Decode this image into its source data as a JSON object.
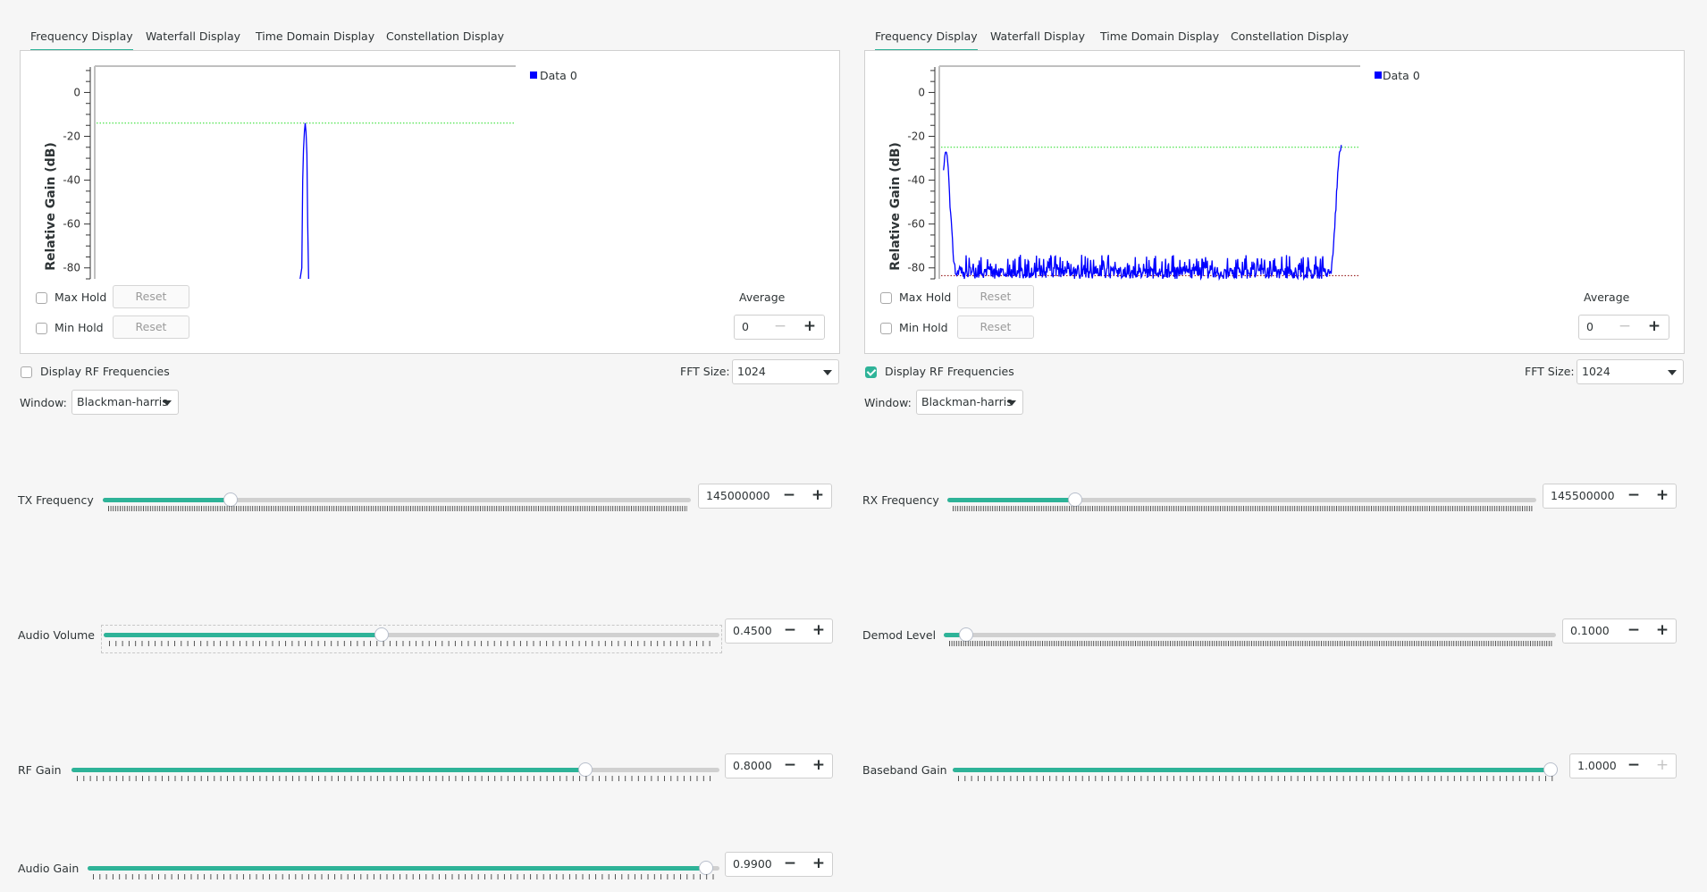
{
  "tabs": [
    "Frequency Display",
    "Waterfall Display",
    "Time Domain Display",
    "Constellation Display"
  ],
  "active_tab": 0,
  "panels": [
    {
      "id": "tx",
      "legend": "Data 0",
      "y_axis_label": "Relative Gain (dB)",
      "max_hold_label": "Max Hold",
      "min_hold_label": "Min Hold",
      "max_hold_checked": false,
      "min_hold_checked": false,
      "reset_label": "Reset",
      "average_label": "Average",
      "average_value": "0",
      "display_rf_label": "Display RF Frequencies",
      "display_rf_checked": false,
      "fft_size_label": "FFT Size:",
      "fft_size_value": "1024",
      "window_label": "Window:",
      "window_value": "Blackman-harris"
    },
    {
      "id": "rx",
      "legend": "Data 0",
      "y_axis_label": "Relative Gain (dB)",
      "max_hold_label": "Max Hold",
      "min_hold_label": "Min Hold",
      "max_hold_checked": false,
      "min_hold_checked": false,
      "reset_label": "Reset",
      "average_label": "Average",
      "average_value": "0",
      "display_rf_label": "Display RF Frequencies",
      "display_rf_checked": true,
      "fft_size_label": "FFT Size:",
      "fft_size_value": "1024",
      "window_label": "Window:",
      "window_value": "Blackman-harris"
    }
  ],
  "controls_left": [
    {
      "label": "TX Frequency",
      "value": "145000000",
      "fraction": 0.21,
      "minus_enabled": true,
      "plus_enabled": true,
      "ticks": "dense"
    },
    {
      "label": "Audio Volume",
      "value": "0.4500",
      "fraction": 0.45,
      "minus_enabled": true,
      "plus_enabled": true,
      "ticks": "sparse",
      "focused": true
    },
    {
      "label": "RF Gain",
      "value": "0.8000",
      "fraction": 0.8,
      "minus_enabled": true,
      "plus_enabled": true,
      "ticks": "sparse"
    },
    {
      "label": "Audio Gain",
      "value": "0.9900",
      "fraction": 0.99,
      "minus_enabled": true,
      "plus_enabled": true,
      "ticks": "sparse"
    }
  ],
  "controls_right": [
    {
      "label": "RX Frequency",
      "value": "145500000",
      "fraction": 0.21,
      "minus_enabled": true,
      "plus_enabled": true,
      "ticks": "dense"
    },
    {
      "label": "Demod Level",
      "value": "0.1000",
      "fraction": 0.025,
      "minus_enabled": true,
      "plus_enabled": true,
      "ticks": "dense"
    },
    {
      "label": "Baseband Gain",
      "value": "1.0000",
      "fraction": 1.0,
      "minus_enabled": true,
      "plus_enabled": false,
      "ticks": "sparse"
    }
  ],
  "colors": {
    "accent": "#2eb398",
    "trace": "#0000ff",
    "max_line": "#22dd22",
    "min_line": "#8b0000"
  },
  "chart_data": [
    {
      "type": "line",
      "title": "",
      "xlabel": "",
      "ylabel": "Relative Gain (dB)",
      "ylim": [
        -85,
        12
      ],
      "yticks": [
        0,
        -20,
        -40,
        -60,
        -80
      ],
      "legend": [
        "Data 0"
      ],
      "legend_position": "top-right-outside",
      "max_hold_level": -14,
      "series": [
        {
          "name": "Data 0",
          "x_fraction": [
            0.488,
            0.492,
            0.494,
            0.496,
            0.498,
            0.5,
            0.502,
            0.504,
            0.506,
            0.508
          ],
          "values": [
            -85,
            -80,
            -40,
            -26,
            -18,
            -14,
            -18,
            -28,
            -60,
            -85
          ]
        }
      ]
    },
    {
      "type": "line",
      "title": "",
      "xlabel": "",
      "ylabel": "Relative Gain (dB)",
      "ylim": [
        -85,
        12
      ],
      "yticks": [
        0,
        -20,
        -40,
        -60,
        -80
      ],
      "legend": [
        "Data 0"
      ],
      "legend_position": "top-right-outside",
      "max_hold_level": -25,
      "min_hold_level": -83.5,
      "series": [
        {
          "name": "Data 0",
          "x_fraction": [
            0.01,
            0.015,
            0.02,
            0.025,
            0.03,
            0.035,
            0.04,
            0.05,
            0.06,
            0.1,
            0.2,
            0.3,
            0.4,
            0.5,
            0.6,
            0.7,
            0.8,
            0.85,
            0.9,
            0.93,
            0.935,
            0.94,
            0.945,
            0.95,
            0.955
          ],
          "values": [
            -37,
            -27,
            -30,
            -50,
            -65,
            -78,
            -83,
            -80,
            -84,
            -82,
            -81,
            -80,
            -82,
            -80,
            -81,
            -80,
            -79,
            -80,
            -78,
            -82,
            -75,
            -60,
            -42,
            -28,
            -25
          ],
          "noise_floor": {
            "range": [
              -85,
              -74
            ]
          }
        }
      ]
    }
  ]
}
